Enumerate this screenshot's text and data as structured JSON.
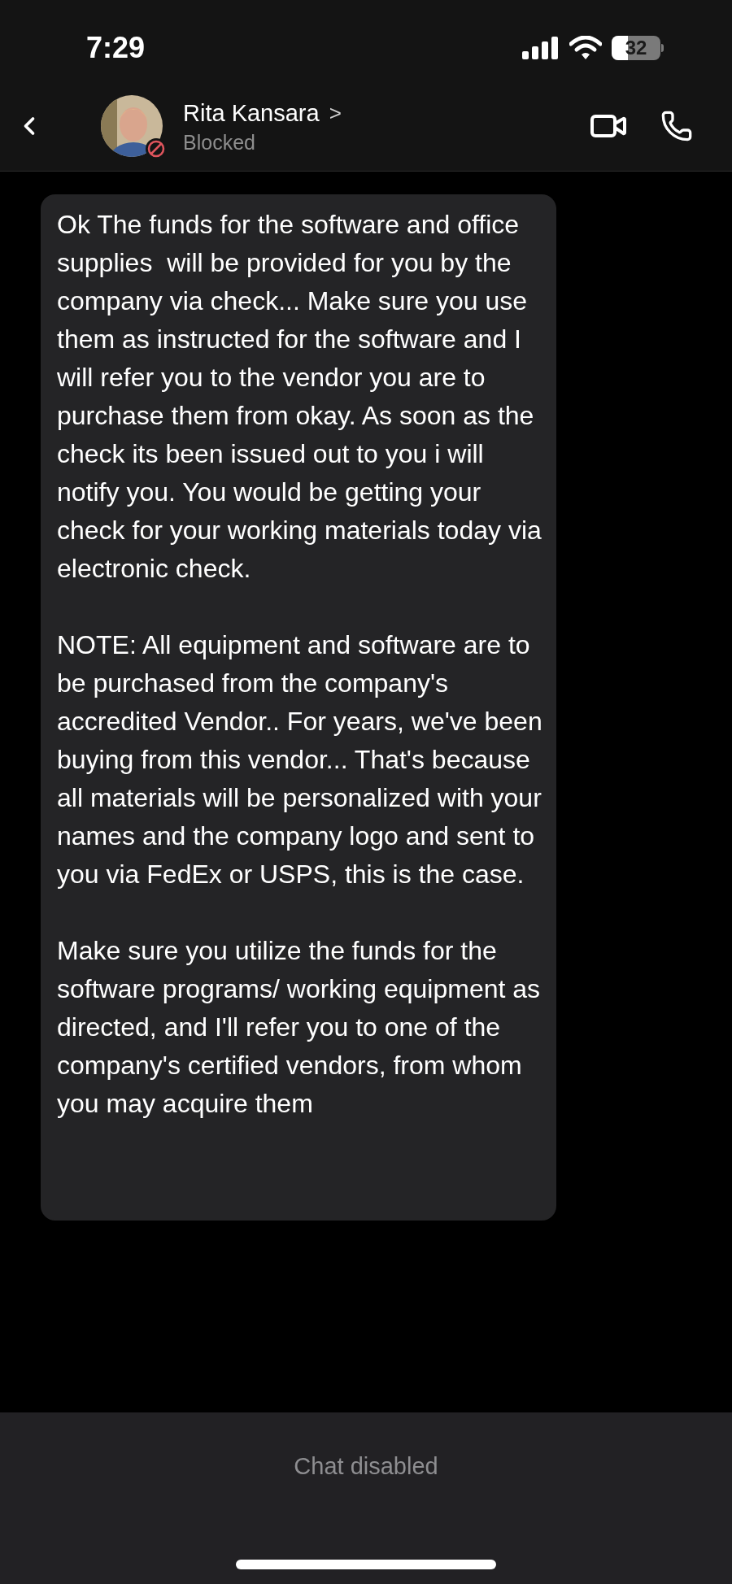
{
  "status_bar": {
    "time": "7:29",
    "battery": "32"
  },
  "header": {
    "name": "Rita Kansara",
    "chevron": ">",
    "status": "Blocked"
  },
  "message": {
    "paragraphs": [
      "Ok The funds for the software and office supplies  will be provided for you by the company via check... Make sure you use them as instructed for the software and I will refer you to the vendor you are to purchase them from okay. As soon as the check its been issued out to you i will notify you. You would be getting your check for your working materials today via electronic check.",
      "NOTE: All equipment and software are to be purchased from the company's accredited Vendor.. For years, we've been buying from this vendor... That's because all materials will be personalized with your names and the company logo and sent to you via FedEx or USPS, this is the case.",
      "Make sure you utilize the funds for the software programs/ working equipment as directed, and I'll refer you to one of the company's certified vendors, from whom you may acquire them"
    ]
  },
  "footer": {
    "notice": "Chat disabled"
  }
}
